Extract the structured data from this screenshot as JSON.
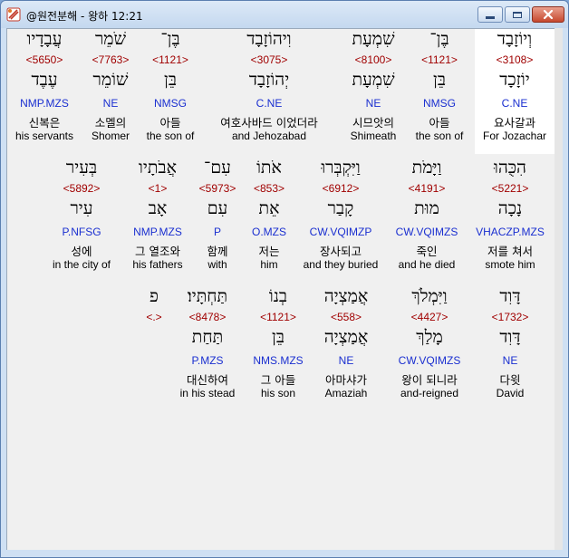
{
  "window": {
    "title": "@원전분해 - 왕하 12:21"
  },
  "rows": [
    {
      "words": [
        {
          "heb1": "וְיוֹזָבָד",
          "strong": "<3108>",
          "heb2": "יוֹזָכָד",
          "morph": "C.NE",
          "kor": "요사갈과",
          "eng": "For Jozachar",
          "highlight": true
        },
        {
          "heb1": "בֶּן־",
          "strong": "<1121>",
          "heb2": "בֵּן",
          "morph": "NMSG",
          "kor": "아들",
          "eng": "the son of"
        },
        {
          "heb1": "שִׁמְעָת",
          "strong": "<8100>",
          "heb2": "שִׁמְעָת",
          "morph": "NE",
          "kor": "시므앗의",
          "eng": "Shimeath"
        },
        {
          "heb1": "וִיהוֹזָבָד",
          "strong": "<3075>",
          "heb2": "יְהוֹזָבָד",
          "morph": "C.NE",
          "kor": "여호사바드 이었더라",
          "eng": "and Jehozabad"
        },
        {
          "heb1": "בֶּן־",
          "strong": "<1121>",
          "heb2": "בֵּן",
          "morph": "NMSG",
          "kor": "아들",
          "eng": "the son of"
        },
        {
          "heb1": "שֹׁמֵר",
          "strong": "<7763>",
          "heb2": "שׁוֹמֵר",
          "morph": "NE",
          "kor": "소멜의",
          "eng": "Shomer"
        },
        {
          "heb1": "עֲבָדָיו",
          "strong": "<5650>",
          "heb2": "עֶבֶד",
          "morph": "NMP.MZS",
          "kor": "신복은",
          "eng": "his servants"
        }
      ]
    },
    {
      "words": [
        {
          "heb1": "הִכֻּהוּ",
          "strong": "<5221>",
          "heb2": "נָכָה",
          "morph": "VHACZP.MZS",
          "kor": "저를 쳐서",
          "eng": "smote him"
        },
        {
          "heb1": "וַיָּמֹת",
          "strong": "<4191>",
          "heb2": "מוּת",
          "morph": "CW.VQIMZS",
          "kor": "죽인",
          "eng": "and he died"
        },
        {
          "heb1": "וַיִּקְבְּרוּ",
          "strong": "<6912>",
          "heb2": "קָבַר",
          "morph": "CW.VQIMZP",
          "kor": "장사되고",
          "eng": "and they buried"
        },
        {
          "heb1": "אֹתוֹ",
          "strong": "<853>",
          "heb2": "אֵת",
          "morph": "O.MZS",
          "kor": "저는",
          "eng": "him"
        },
        {
          "heb1": "עִם־",
          "strong": "<5973>",
          "heb2": "עִם",
          "morph": "P",
          "kor": "함께",
          "eng": "with"
        },
        {
          "heb1": "אֲבֹתָיו",
          "strong": "<1>",
          "heb2": "אָב",
          "morph": "NMP.MZS",
          "kor": "그 열조와",
          "eng": "his fathers"
        },
        {
          "heb1": "בְּעִיר",
          "strong": "<5892>",
          "heb2": "עִיר",
          "morph": "P.NFSG",
          "kor": "성에",
          "eng": "in the city of"
        }
      ]
    },
    {
      "words": [
        {
          "heb1": "דָּוִד",
          "strong": "<1732>",
          "heb2": "דָּוִד",
          "morph": "NE",
          "kor": "다윗",
          "eng": "David"
        },
        {
          "heb1": "וַיִּמְלֹךְ",
          "strong": "<4427>",
          "heb2": "מָלַךְ",
          "morph": "CW.VQIMZS",
          "kor": "왕이 되니라",
          "eng": "and-reigned"
        },
        {
          "heb1": "אֲמַצְיָה",
          "strong": "<558>",
          "heb2": "אֲמַצְיָה",
          "morph": "NE",
          "kor": "아마샤가",
          "eng": "Amaziah"
        },
        {
          "heb1": "בְנוֹ",
          "strong": "<1121>",
          "heb2": "בֵּן",
          "morph": "NMS.MZS",
          "kor": "그 아들",
          "eng": "his son"
        },
        {
          "heb1": "תַּחְתָּיו׃",
          "strong": "<8478>",
          "heb2": "תַּחַת",
          "morph": "P.MZS",
          "kor": "대신하여",
          "eng": "in his stead"
        },
        {
          "heb1": "פ",
          "strong": "<.>",
          "heb2": "",
          "morph": "",
          "kor": "",
          "eng": ""
        }
      ]
    }
  ]
}
